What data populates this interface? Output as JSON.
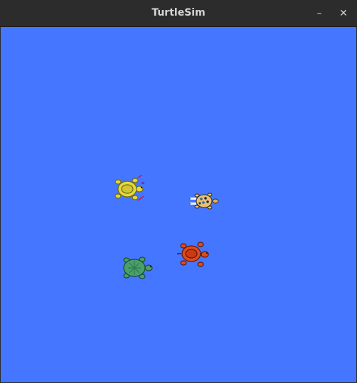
{
  "window": {
    "title": "TurtleSim",
    "minimize_glyph": "–",
    "close_glyph": "✕"
  },
  "canvas": {
    "background_color": "#4576ff"
  },
  "turtles": [
    {
      "name": "yellow-turtle",
      "shell_color": "#e3d83c"
    },
    {
      "name": "patterned-turtle",
      "shell_color": "#e8c070"
    },
    {
      "name": "red-turtle",
      "shell_color": "#e04a1e"
    },
    {
      "name": "green-turtle",
      "shell_color": "#4aa06a"
    }
  ]
}
